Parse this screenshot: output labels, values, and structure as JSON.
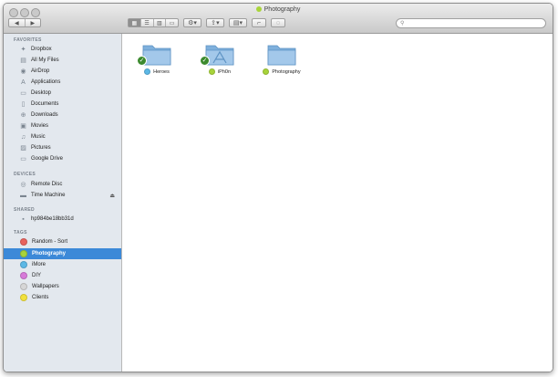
{
  "window": {
    "title": "Photography",
    "title_tag_color": "#a8d43a"
  },
  "toolbar": {
    "back_icon": "chevron-left-icon",
    "forward_icon": "chevron-right-icon",
    "view_modes": [
      "icon-view-icon",
      "list-view-icon",
      "column-view-icon",
      "coverflow-view-icon"
    ],
    "action_icon": "gear-icon",
    "share_icon": "share-icon",
    "arrange_icon": "arrange-icon",
    "edit_tags_icon": "tag-icon",
    "search_icon": "search-icon",
    "search_placeholder": ""
  },
  "sidebar": {
    "favorites_header": "FAVORITES",
    "favorites": [
      {
        "label": "Dropbox",
        "icon": "dropbox-icon"
      },
      {
        "label": "All My Files",
        "icon": "all-files-icon"
      },
      {
        "label": "AirDrop",
        "icon": "airdrop-icon"
      },
      {
        "label": "Applications",
        "icon": "applications-icon"
      },
      {
        "label": "Desktop",
        "icon": "desktop-icon"
      },
      {
        "label": "Documents",
        "icon": "documents-icon"
      },
      {
        "label": "Downloads",
        "icon": "downloads-icon"
      },
      {
        "label": "Movies",
        "icon": "movies-icon"
      },
      {
        "label": "Music",
        "icon": "music-icon"
      },
      {
        "label": "Pictures",
        "icon": "pictures-icon"
      },
      {
        "label": "Google Drive",
        "icon": "folder-icon"
      }
    ],
    "devices_header": "DEVICES",
    "devices": [
      {
        "label": "Remote Disc",
        "icon": "disc-icon"
      },
      {
        "label": "Time Machine",
        "icon": "drive-icon",
        "eject": "⏏"
      }
    ],
    "shared_header": "SHARED",
    "shared": [
      {
        "label": "hp984be18bb31d",
        "icon": "network-icon"
      }
    ],
    "tags_header": "TAGS",
    "tags": [
      {
        "label": "Random - Sort",
        "color": "#e8625d"
      },
      {
        "label": "Photography",
        "color": "#a8d43a",
        "selected": true
      },
      {
        "label": "iMore",
        "color": "#5cb8e6"
      },
      {
        "label": "DIY",
        "color": "#d77ad9"
      },
      {
        "label": "Wallpapers",
        "color": "#d6d6d6"
      },
      {
        "label": "Clients",
        "color": "#f2e13c"
      }
    ]
  },
  "content": {
    "items": [
      {
        "label": "Heroes",
        "tag_color": "#5cb8e6",
        "synced": true,
        "type": "folder"
      },
      {
        "label": "iPh0n",
        "tag_color": "#a8d43a",
        "synced": true,
        "type": "app-folder"
      },
      {
        "label": "Photography",
        "tag_color": "#a8d43a",
        "synced": false,
        "type": "folder"
      }
    ]
  }
}
